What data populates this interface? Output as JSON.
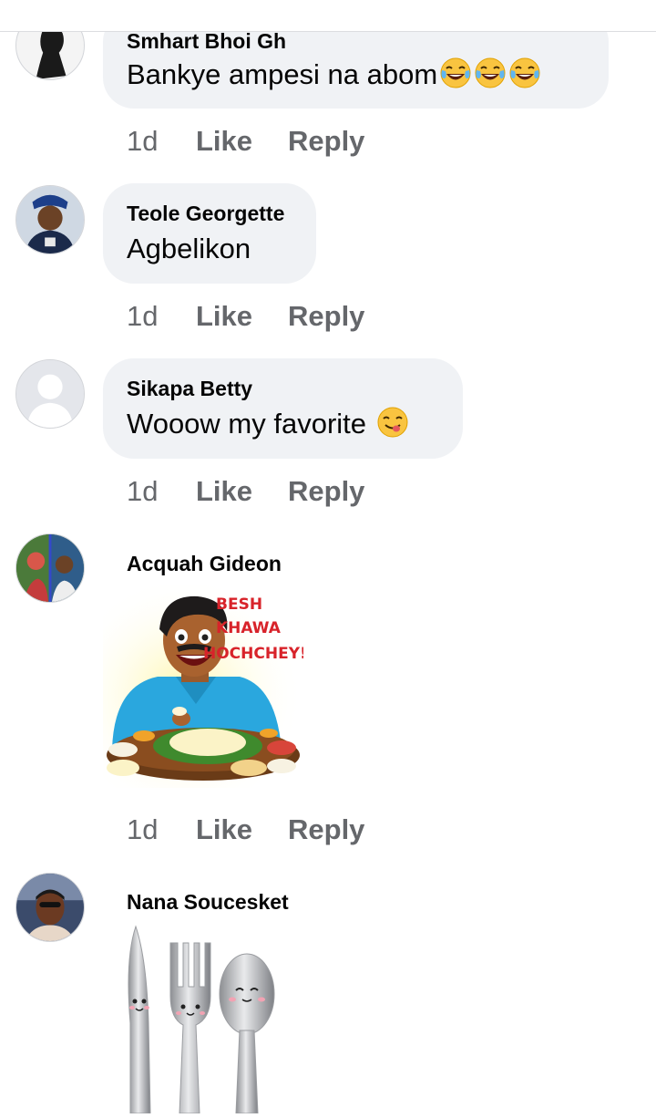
{
  "comments": [
    {
      "name": "Smhart Bhoi Gh",
      "text": "Bankye ampesi na abom",
      "emoji": [
        "tears-of-joy",
        "tears-of-joy",
        "tears-of-joy"
      ],
      "time": "1d",
      "like": "Like",
      "reply": "Reply"
    },
    {
      "name": "Teole Georgette",
      "text": "Agbelikon",
      "time": "1d",
      "like": "Like",
      "reply": "Reply"
    },
    {
      "name": "Sikapa Betty",
      "text": "Wooow my favorite",
      "emoji": [
        "savoring-food"
      ],
      "time": "1d",
      "like": "Like",
      "reply": "Reply"
    },
    {
      "name": "Acquah Gideon",
      "sticker": "man-eating-meal",
      "sticker_text": [
        "BESH",
        "KHAWA",
        "HOCHCHEY!"
      ],
      "time": "1d",
      "like": "Like",
      "reply": "Reply"
    },
    {
      "name": "Nana Soucesket",
      "sticker": "knife-fork-spoon"
    }
  ],
  "colors": {
    "bubble": "#f0f2f5",
    "meta_text": "#65676b",
    "name_text": "#050505"
  }
}
